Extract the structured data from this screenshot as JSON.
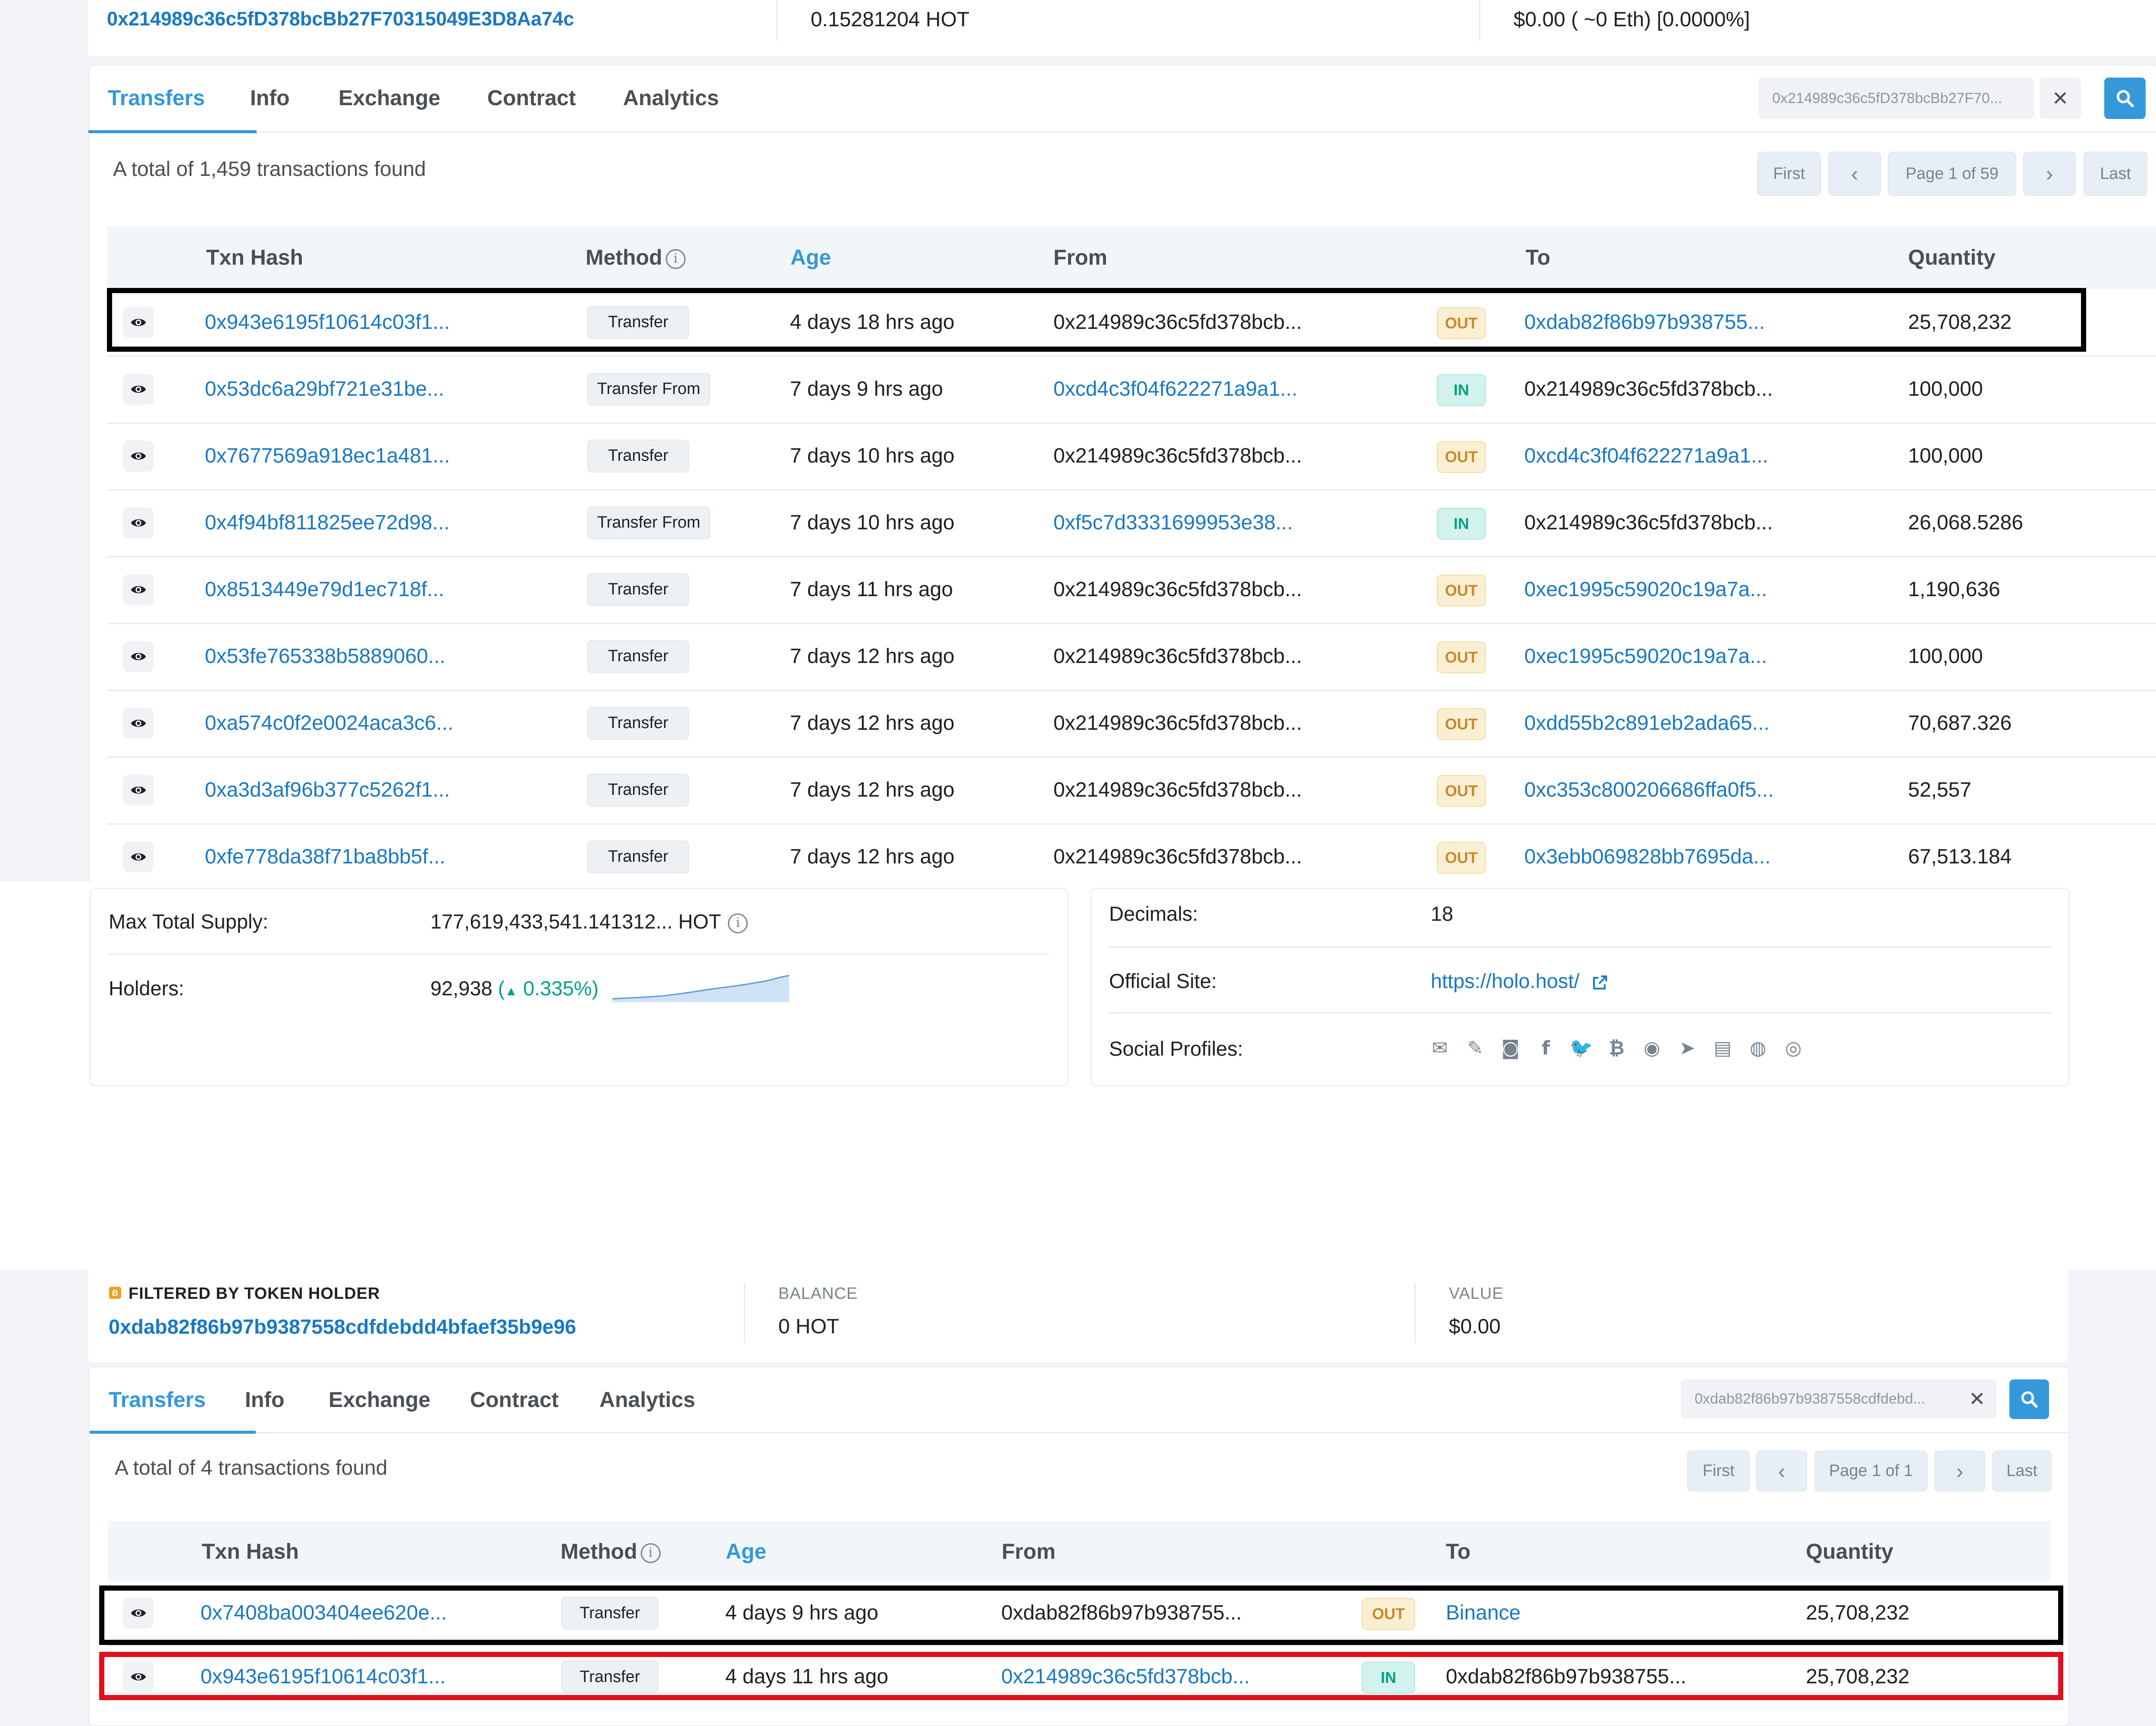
{
  "top": {
    "holder_address": "0x214989c36c5fD378bcBb27F70315049E3D8Aa74c",
    "balance": "0.15281204 HOT",
    "value": "$0.00 ( ~0 Eth) [0.0000%]",
    "tabs": [
      "Transfers",
      "Info",
      "Exchange",
      "Contract",
      "Analytics"
    ],
    "filter_value": "0x214989c36c5fD378bcBb27F70...",
    "total_text": "A total of 1,459 transactions found",
    "pagination": {
      "first": "First",
      "prev": "‹",
      "page": "Page 1 of 59",
      "next": "›",
      "last": "Last"
    },
    "columns": {
      "hash": "Txn Hash",
      "method": "Method",
      "age": "Age",
      "from": "From",
      "to": "To",
      "qty": "Quantity"
    },
    "rows": [
      {
        "hash": "0x943e6195f10614c03f1...",
        "method": "Transfer",
        "age": "4 days 18 hrs ago",
        "from": "0x214989c36c5fd378bcb...",
        "dir": "OUT",
        "to": "0xdab82f86b97b938755...",
        "qty": "25,708,232"
      },
      {
        "hash": "0x53dc6a29bf721e31be...",
        "method": "Transfer From",
        "age": "7 days 9 hrs ago",
        "from": "0xcd4c3f04f622271a9a1...",
        "dir": "IN",
        "to": "0x214989c36c5fd378bcb...",
        "qty": "100,000"
      },
      {
        "hash": "0x7677569a918ec1a481...",
        "method": "Transfer",
        "age": "7 days 10 hrs ago",
        "from": "0x214989c36c5fd378bcb...",
        "dir": "OUT",
        "to": "0xcd4c3f04f622271a9a1...",
        "qty": "100,000"
      },
      {
        "hash": "0x4f94bf811825ee72d98...",
        "method": "Transfer From",
        "age": "7 days 10 hrs ago",
        "from": "0xf5c7d3331699953e38...",
        "dir": "IN",
        "to": "0x214989c36c5fd378bcb...",
        "qty": "26,068.5286"
      },
      {
        "hash": "0x8513449e79d1ec718f...",
        "method": "Transfer",
        "age": "7 days 11 hrs ago",
        "from": "0x214989c36c5fd378bcb...",
        "dir": "OUT",
        "to": "0xec1995c59020c19a7a...",
        "qty": "1,190,636"
      },
      {
        "hash": "0x53fe765338b5889060...",
        "method": "Transfer",
        "age": "7 days 12 hrs ago",
        "from": "0x214989c36c5fd378bcb...",
        "dir": "OUT",
        "to": "0xec1995c59020c19a7a...",
        "qty": "100,000"
      },
      {
        "hash": "0xa574c0f2e0024aca3c6...",
        "method": "Transfer",
        "age": "7 days 12 hrs ago",
        "from": "0x214989c36c5fd378bcb...",
        "dir": "OUT",
        "to": "0xdd55b2c891eb2ada65...",
        "qty": "70,687.326"
      },
      {
        "hash": "0xa3d3af96b377c5262f1...",
        "method": "Transfer",
        "age": "7 days 12 hrs ago",
        "from": "0x214989c36c5fd378bcb...",
        "dir": "OUT",
        "to": "0xc353c800206686ffa0f5...",
        "qty": "52,557"
      },
      {
        "hash": "0xfe778da38f71ba8bb5f...",
        "method": "Transfer",
        "age": "7 days 12 hrs ago",
        "from": "0x214989c36c5fd378bcb...",
        "dir": "OUT",
        "to": "0x3ebb069828bb7695da...",
        "qty": "67,513.184"
      }
    ]
  },
  "overview": {
    "max_supply_label": "Max Total Supply:",
    "max_supply_value": "177,619,433,541.141312... HOT",
    "holders_label": "Holders:",
    "holders_value": "92,938",
    "holders_change": "0.335%",
    "decimals_label": "Decimals:",
    "decimals_value": "18",
    "site_label": "Official Site:",
    "site_value": "https://holo.host/",
    "social_label": "Social Profiles:",
    "social_icons": [
      "email-icon",
      "pencil-icon",
      "reddit-icon",
      "facebook-icon",
      "twitter-icon",
      "bitcointalk-icon",
      "github-icon",
      "telegram-icon",
      "whitepaper-icon",
      "coinmarketcap-icon",
      "coingecko-icon"
    ]
  },
  "bottom": {
    "filtered_label": "FILTERED BY TOKEN HOLDER",
    "holder_address": "0xdab82f86b97b9387558cdfdebdd4bfaef35b9e96",
    "balance_label": "BALANCE",
    "balance_value": "0 HOT",
    "value_label": "VALUE",
    "value_value": "$0.00",
    "tabs": [
      "Transfers",
      "Info",
      "Exchange",
      "Contract",
      "Analytics"
    ],
    "filter_value": "0xdab82f86b97b9387558cdfdebd...",
    "total_text": "A total of 4 transactions found",
    "pagination": {
      "first": "First",
      "prev": "‹",
      "page": "Page 1 of 1",
      "next": "›",
      "last": "Last"
    },
    "columns": {
      "hash": "Txn Hash",
      "method": "Method",
      "age": "Age",
      "from": "From",
      "to": "To",
      "qty": "Quantity"
    },
    "rows": [
      {
        "hash": "0x7408ba003404ee620e...",
        "method": "Transfer",
        "age": "4 days 9 hrs ago",
        "from": "0xdab82f86b97b938755...",
        "dir": "OUT",
        "to": "Binance",
        "qty": "25,708,232"
      },
      {
        "hash": "0x943e6195f10614c03f1...",
        "method": "Transfer",
        "age": "4 days 11 hrs ago",
        "from": "0x214989c36c5fd378bcb...",
        "dir": "IN",
        "to": "0xdab82f86b97b938755...",
        "qty": "25,708,232"
      }
    ]
  },
  "colors": {
    "accent": "#3498db",
    "link": "#1a78c2",
    "highlight_black": "#000000",
    "highlight_red": "#e0101e",
    "out_badge": "#fbefd3",
    "in_badge": "#d3f2ee"
  }
}
